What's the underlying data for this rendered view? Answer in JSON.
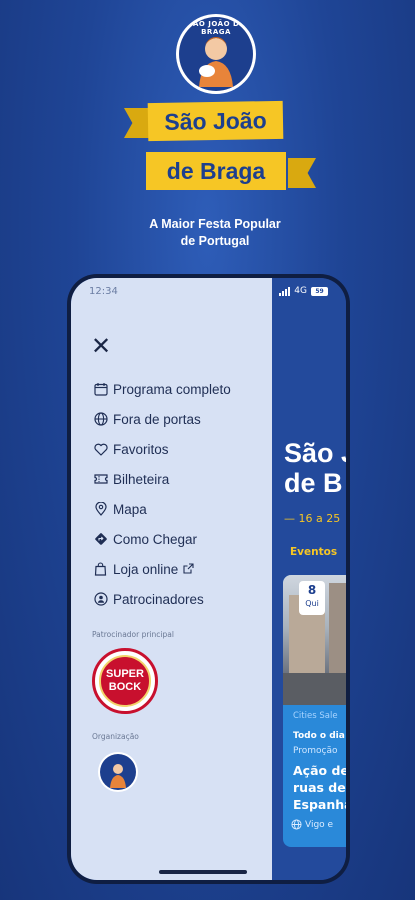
{
  "promo": {
    "logo_text": "SÃO JOÃO DE BRAGA",
    "banner_line1": "São João",
    "banner_line2": "de Braga",
    "tagline_line1": "A Maior Festa Popular",
    "tagline_line2": "de Portugal"
  },
  "status_bar": {
    "time": "12:34",
    "network": "4G",
    "battery": "59"
  },
  "app": {
    "title": "São J\nde B",
    "dates": "— 16 a 25",
    "tab_events": "Eventos",
    "card": {
      "day": "8",
      "weekday": "Qui",
      "category": "Cities Sale",
      "when": "Todo o dia",
      "tag": "Promoção",
      "name": "Ação de\nruas de\nEspanha",
      "location": "Vigo e"
    }
  },
  "drawer": {
    "menu": [
      {
        "label": "Programa completo",
        "icon": "calendar-icon"
      },
      {
        "label": "Fora de portas",
        "icon": "globe-icon"
      },
      {
        "label": "Favoritos",
        "icon": "heart-icon"
      },
      {
        "label": "Bilheteira",
        "icon": "ticket-icon"
      },
      {
        "label": "Mapa",
        "icon": "map-pin-icon"
      },
      {
        "label": "Como Chegar",
        "icon": "directions-icon"
      },
      {
        "label": "Loja online",
        "icon": "shopping-bag-icon"
      },
      {
        "label": "Patrocinadores",
        "icon": "sponsor-icon"
      }
    ],
    "sponsor_label": "Patrocinador principal",
    "sponsor_name_line1": "SUPER",
    "sponsor_name_line2": "BOCK",
    "org_label": "Organização"
  },
  "colors": {
    "background": "#1f4596",
    "banner_yellow": "#f6c625",
    "drawer_bg": "#d7e1f4",
    "accent_blue": "#2a89d9"
  }
}
